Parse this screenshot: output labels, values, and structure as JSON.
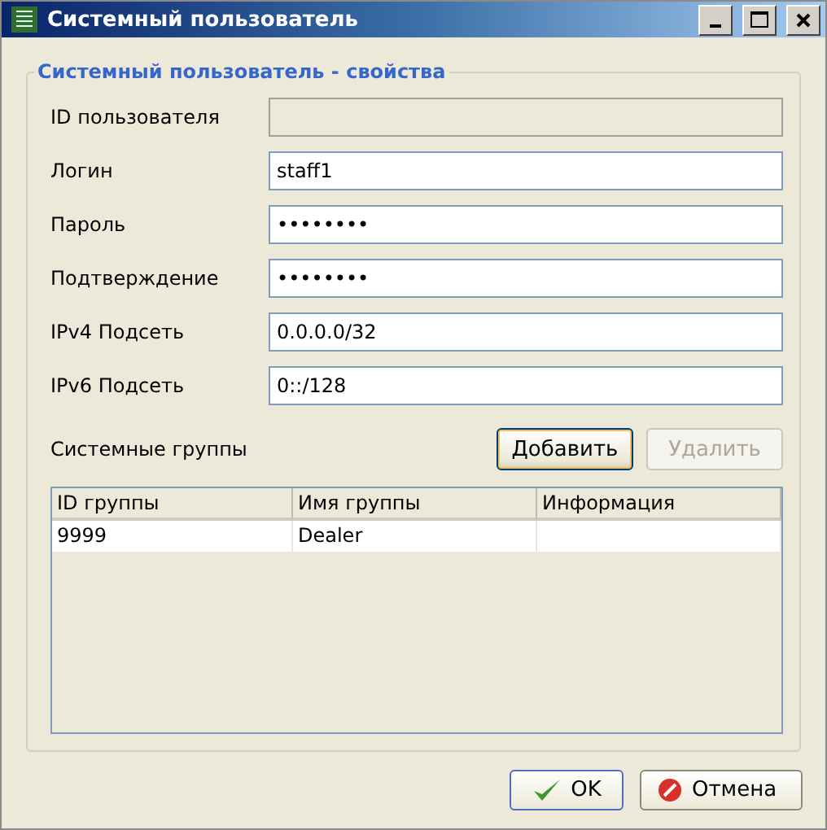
{
  "window": {
    "title": "Системный пользователь"
  },
  "group": {
    "title": "Системный пользователь - свойства"
  },
  "fields": [
    {
      "label": "ID пользователя",
      "disabled": true
    },
    {
      "label": "Логин",
      "value": "staff1",
      "disabled": false
    },
    {
      "label": "Пароль",
      "value": "••••••••",
      "disabled": false
    },
    {
      "label": "Подтверждение",
      "value": "••••••••",
      "disabled": false
    },
    {
      "label": "IPv4 Подсеть",
      "value": "0.0.0.0/32",
      "disabled": false
    },
    {
      "label": "IPv6 Подсеть",
      "value": "0::/128",
      "disabled": false
    }
  ],
  "groups_section": {
    "label": "Системные группы",
    "buttons": [
      {
        "label": "Добавить",
        "disabled": false
      },
      {
        "label": "Удалить",
        "disabled": true
      }
    ]
  },
  "table": {
    "columns": [
      "ID группы",
      "Имя группы",
      "Информация"
    ],
    "rows": [
      [
        "9999",
        "Dealer",
        ""
      ]
    ]
  },
  "buttons": [
    {
      "label": "OK",
      "kind": "ok"
    },
    {
      "label": "Отмена",
      "kind": "cancel"
    }
  ]
}
